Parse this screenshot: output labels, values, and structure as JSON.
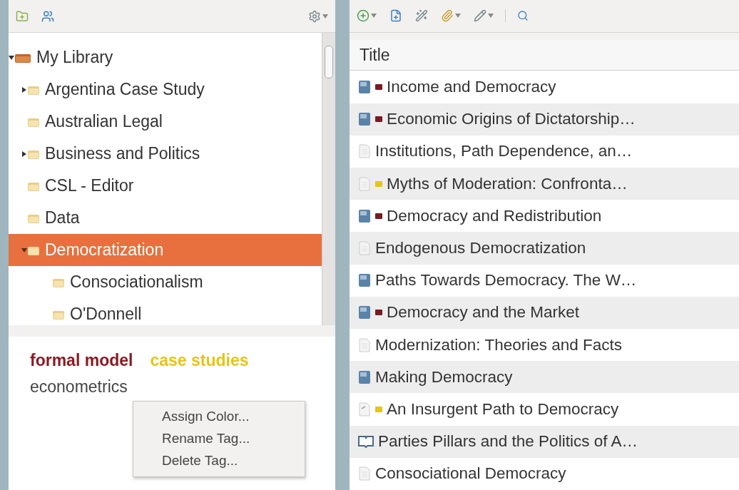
{
  "collections": [
    {
      "label": "My Library",
      "kind": "library",
      "expanded": true,
      "selected": false,
      "children": [
        {
          "label": "Argentina Case Study",
          "kind": "folder",
          "expanded": false,
          "selected": false
        },
        {
          "label": "Australian Legal",
          "kind": "folder",
          "selected": false
        },
        {
          "label": "Business and Politics",
          "kind": "folder",
          "expanded": false,
          "selected": false
        },
        {
          "label": "CSL - Editor",
          "kind": "folder",
          "selected": false
        },
        {
          "label": "Data",
          "kind": "folder",
          "selected": false
        },
        {
          "label": "Democratization",
          "kind": "folder",
          "expanded": true,
          "selected": true,
          "children": [
            {
              "label": "Consociationalism",
              "kind": "folder",
              "selected": false
            },
            {
              "label": "O'Donnell",
              "kind": "folder",
              "selected": false
            }
          ]
        }
      ]
    }
  ],
  "tags": [
    {
      "label": "formal model",
      "color": "#8b1a22"
    },
    {
      "label": "case studies",
      "color": "#e6c419"
    },
    {
      "label": "econometrics",
      "color": "#444444"
    }
  ],
  "context_menu": [
    "Assign Color...",
    "Rename Tag...",
    "Delete Tag..."
  ],
  "items_table": {
    "column": "Title",
    "rows": [
      {
        "title": "Income and Democracy",
        "kind": "book",
        "color": "#7a1a22"
      },
      {
        "title": "Economic Origins of Dictatorship…",
        "kind": "book",
        "color": "#7a1a22"
      },
      {
        "title": "Institutions, Path Dependence, an…",
        "kind": "document"
      },
      {
        "title": "Myths of Moderation: Confronta…",
        "kind": "document",
        "color": "#e6c419"
      },
      {
        "title": "Democracy and Redistribution",
        "kind": "book",
        "color": "#7a1a22"
      },
      {
        "title": "Endogenous Democratization",
        "kind": "document"
      },
      {
        "title": "Paths Towards Democracy. The W…",
        "kind": "book"
      },
      {
        "title": "Democracy and the Market",
        "kind": "book",
        "color": "#7a1a22"
      },
      {
        "title": "Modernization: Theories and Facts",
        "kind": "document"
      },
      {
        "title": "Making Democracy",
        "kind": "book"
      },
      {
        "title": "An Insurgent Path to Democracy",
        "kind": "article",
        "color": "#e6c419"
      },
      {
        "title": "Parties Pillars and the Politics of A…",
        "kind": "section"
      },
      {
        "title": "Consociational Democracy",
        "kind": "document"
      }
    ]
  }
}
